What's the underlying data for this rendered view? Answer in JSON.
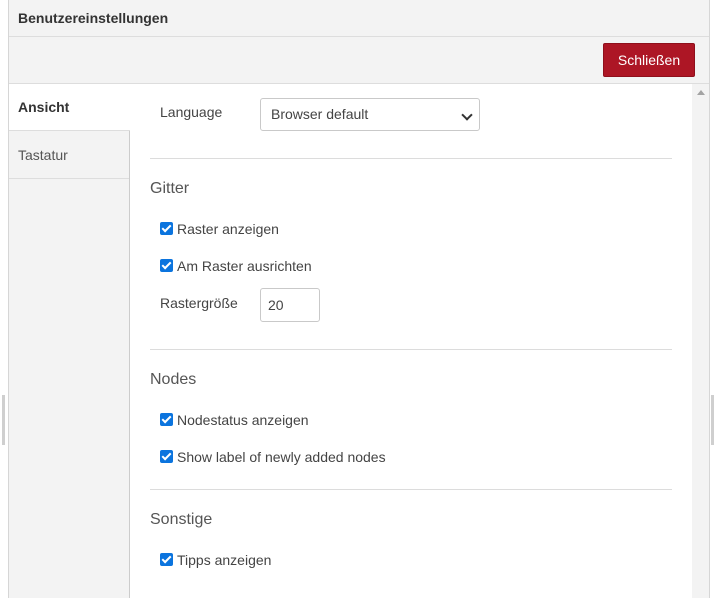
{
  "dialog": {
    "title": "Benutzereinstellungen",
    "close_label": "Schließen"
  },
  "tabs": [
    {
      "label": "Ansicht",
      "active": true
    },
    {
      "label": "Tastatur",
      "active": false
    }
  ],
  "view": {
    "language": {
      "label": "Language",
      "value": "Browser default"
    },
    "grid": {
      "heading": "Gitter",
      "show_grid": {
        "label": "Raster anzeigen",
        "checked": true
      },
      "snap_to_grid": {
        "label": "Am Raster ausrichten",
        "checked": true
      },
      "grid_size": {
        "label": "Rastergröße",
        "value": "20"
      }
    },
    "nodes": {
      "heading": "Nodes",
      "show_status": {
        "label": "Nodestatus anzeigen",
        "checked": true
      },
      "show_label": {
        "label": "Show label of newly added nodes",
        "checked": true
      }
    },
    "other": {
      "heading": "Sonstige",
      "show_tips": {
        "label": "Tipps anzeigen",
        "checked": true
      }
    }
  },
  "colors": {
    "accent": "#ad1625",
    "checkbox": "#0b74de",
    "panel_bg": "#f3f3f3"
  }
}
